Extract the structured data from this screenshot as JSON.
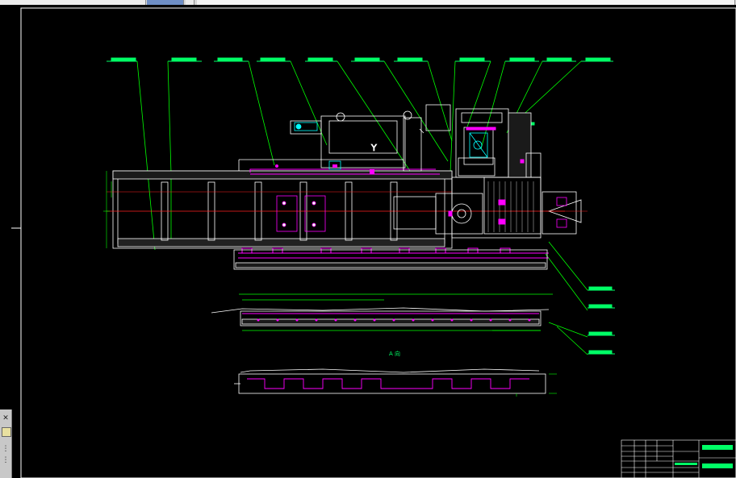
{
  "view_label": "A 向",
  "title_block": {
    "name_line_1": "",
    "name_line_2": ""
  },
  "colors": {
    "background": "#000000",
    "frame": "#ffffff",
    "leader": "#00ff00",
    "centerline": "#ff2020",
    "part_magenta": "#ff00ff",
    "part_cyan": "#00ffff",
    "callout": "#00ff66"
  },
  "icons": {
    "toolbox_top": "close-icon",
    "toolbox_mid": "layer-icon"
  }
}
